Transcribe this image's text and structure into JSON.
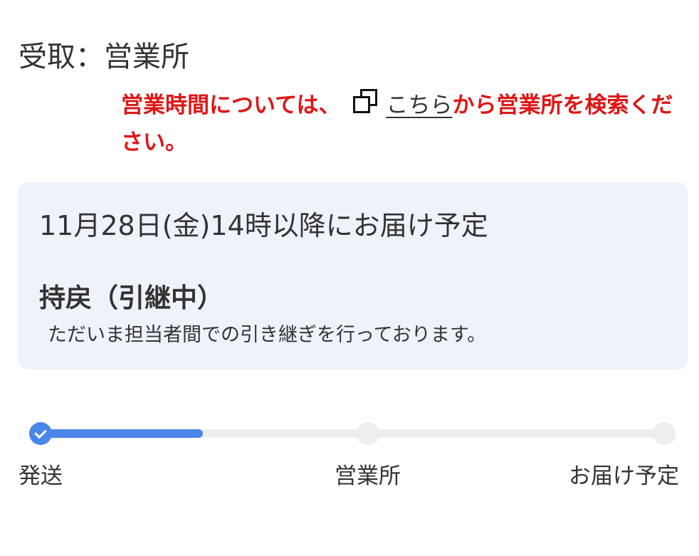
{
  "receive": {
    "label": "受取：営業所"
  },
  "notice": {
    "prefix": "営業時間については、",
    "link_label": "こちら",
    "suffix": "から営業所を検索ください。",
    "link_icon": "copy-icon",
    "color": "#e01515"
  },
  "status_card": {
    "eta": "11月28日(金)14時以降にお届け予定",
    "status_title": "持戻（引継中）",
    "status_description": "ただいま担当者間での引き継ぎを行っております。",
    "background": "#eef3fb"
  },
  "progress": {
    "steps": [
      {
        "label": "発送",
        "state": "done"
      },
      {
        "label": "営業所",
        "state": "pending"
      },
      {
        "label": "お届け予定",
        "state": "pending"
      }
    ],
    "completed_fraction": 0.26,
    "accent": "#4a86e8"
  }
}
